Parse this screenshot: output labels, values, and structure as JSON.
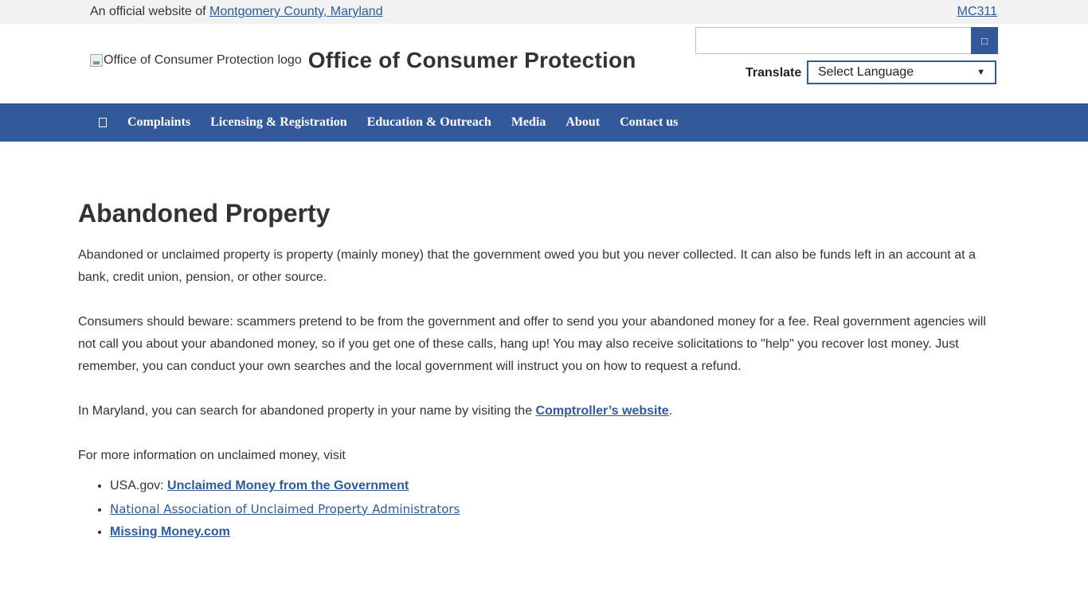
{
  "official_bar": {
    "prefix": "An official website of",
    "county_link": "Montgomery County, Maryland",
    "mc311_link": "MC311"
  },
  "header": {
    "logo_alt": "Office of Consumer Protection logo",
    "title": "Office of Consumer Protection",
    "search_placeholder": "",
    "search_button_icon": "search-icon",
    "translate_label": "Translate",
    "language_selected": "Select Language"
  },
  "nav": {
    "home_icon": "home-icon",
    "items": [
      "Complaints",
      "Licensing & Registration",
      "Education & Outreach",
      "Media",
      "About",
      "Contact us"
    ]
  },
  "content": {
    "title": "Abandoned Property",
    "p1": "Abandoned or unclaimed property is property (mainly money) that the government owed you but you never collected.  It can also be funds left in an account at a bank, credit union,  pension, or other source.",
    "p2": "Consumers should beware: scammers pretend to be from the government and offer to send you your abandoned money for a fee.  Real government agencies will not call you about your abandoned money, so if you get one of these calls, hang up!  You may also receive solicitations to \"help\" you recover lost money.  Just remember, you can conduct your own searches and the local government will instruct you on how to request a refund.",
    "p3_prefix": "In Maryland, you can search for abandoned property in your name by visiting the ",
    "p3_link": "Comptroller’s website",
    "p3_suffix": ".",
    "p4": "For more information on unclaimed money, visit",
    "links": {
      "usagov_prefix": "USA.gov: ",
      "usagov_link": "Unclaimed Money from the Government",
      "naupa_link": "National Association of Unclaimed Property Administrators",
      "missing_link": "Missing Money.com"
    }
  },
  "colors": {
    "brand_blue": "#34599a",
    "link": "#2f5a9a",
    "top_bar_bg": "#f2f2f2"
  }
}
